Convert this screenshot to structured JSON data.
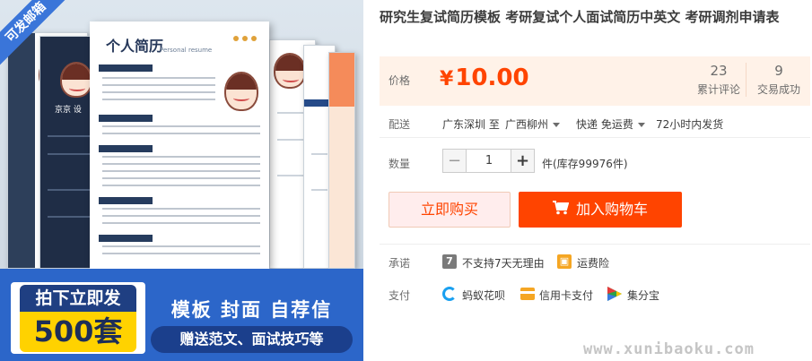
{
  "product_image": {
    "badge": "可发邮箱",
    "resume_title": "个人简历",
    "resume_sub": "Personal resume",
    "card_name": "京京 设",
    "promo_left_top": "拍下立即发",
    "promo_left_big": "500套",
    "promo_right_top": "模板 封面 自荐信",
    "promo_right_bar": "赠送范文、面试技巧等"
  },
  "product": {
    "title": "研究生复试简历模板 考研复试个人面试简历中英文 考研调剂申请表"
  },
  "price": {
    "label": "价格",
    "symbol": "¥",
    "value": "10.00",
    "accent_color": "#ff4400"
  },
  "stats": {
    "reviews_count": "23",
    "reviews_label": "累计评论",
    "sales_count": "9",
    "sales_label": "交易成功"
  },
  "shipping": {
    "label": "配送",
    "from": "广东深圳 至",
    "to": "广西柳州",
    "method": "快递 免运费",
    "time": "72小时内发货"
  },
  "quantity": {
    "label": "数量",
    "minus": "−",
    "value": "1",
    "plus": "+",
    "stock": "件(库存99976件)"
  },
  "actions": {
    "buy_now": "立即购买",
    "add_to_cart": "加入购物车"
  },
  "promise": {
    "label": "承诺",
    "items": [
      {
        "icon": "no-return-icon",
        "text": "不支持7天无理由"
      },
      {
        "icon": "shipping-insurance-icon",
        "text": "运费险"
      }
    ]
  },
  "payment": {
    "label": "支付",
    "items": [
      {
        "icon": "huabei-icon",
        "text": "蚂蚁花呗"
      },
      {
        "icon": "credit-card-icon",
        "text": "信用卡支付"
      },
      {
        "icon": "jifenbao-icon",
        "text": "集分宝"
      }
    ]
  },
  "watermark": "www.xunibaoku.com"
}
